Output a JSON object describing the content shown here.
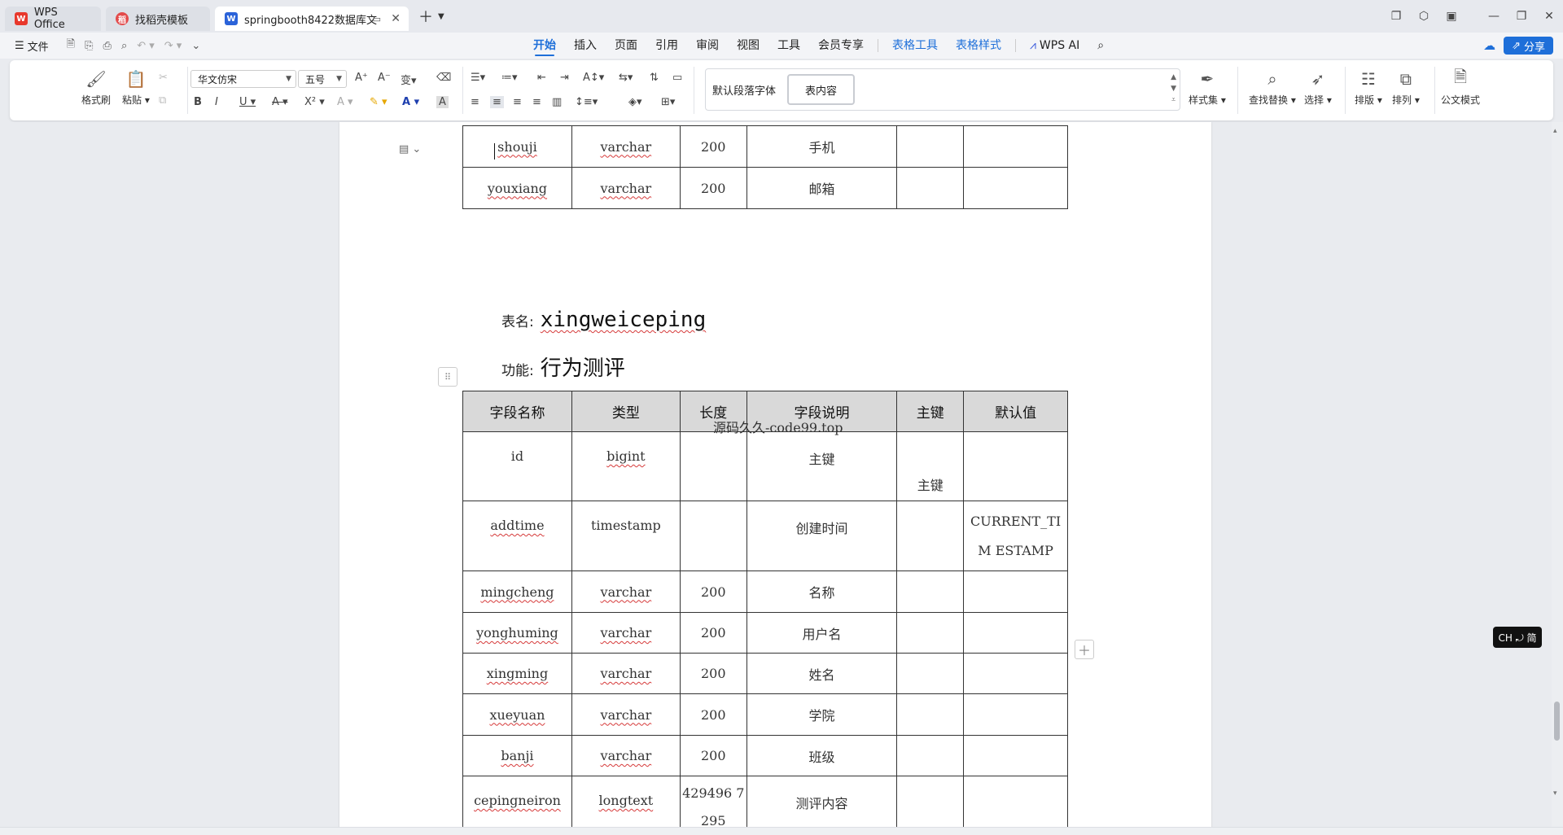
{
  "tabs": [
    {
      "label": "WPS Office",
      "logo": "W"
    },
    {
      "label": "找稻壳模板",
      "logo": "稻"
    },
    {
      "label": "springbooth8422数据库文",
      "logo": "W"
    }
  ],
  "menubar": {
    "file": "文件",
    "items": [
      "开始",
      "插入",
      "页面",
      "引用",
      "审阅",
      "视图",
      "工具",
      "会员专享"
    ],
    "table_tools": "表格工具",
    "table_style": "表格样式",
    "ai": "WPS AI",
    "share": "分享"
  },
  "ribbon": {
    "format_painter": "格式刷",
    "paste": "粘贴",
    "font_name": "华文仿宋",
    "font_size": "五号",
    "style_default": "默认段落字体",
    "style_selected": "表内容",
    "style_set": "样式集",
    "find_replace": "查找替换",
    "select": "选择",
    "layout": "排版",
    "arrange": "排列",
    "official": "公文模式"
  },
  "doc": {
    "top_rows": [
      {
        "name": "shouji",
        "type": "varchar",
        "length": "200",
        "desc": "手机",
        "pk": "",
        "default": ""
      },
      {
        "name": "youxiang",
        "type": "varchar",
        "length": "200",
        "desc": "邮箱",
        "pk": "",
        "default": ""
      }
    ],
    "table_label": "表名:",
    "table_name": "xingweiceping",
    "func_label": "功能:",
    "func_name": "行为测评",
    "headers": [
      "字段名称",
      "类型",
      "长度",
      "字段说明",
      "主键",
      "默认值"
    ],
    "watermark": "源码久久-code99.top",
    "rows": [
      {
        "name": "id",
        "type": "bigint",
        "length": "",
        "desc": "主键",
        "pk": "主键",
        "default": ""
      },
      {
        "name": "addtime",
        "type": "timestamp",
        "length": "",
        "desc": "创建时间",
        "pk": "",
        "default": "CURRENT_TIM ESTAMP"
      },
      {
        "name": "mingcheng",
        "type": "varchar",
        "length": "200",
        "desc": "名称",
        "pk": "",
        "default": ""
      },
      {
        "name": "yonghuming",
        "type": "varchar",
        "length": "200",
        "desc": "用户名",
        "pk": "",
        "default": ""
      },
      {
        "name": "xingming",
        "type": "varchar",
        "length": "200",
        "desc": "姓名",
        "pk": "",
        "default": ""
      },
      {
        "name": "xueyuan",
        "type": "varchar",
        "length": "200",
        "desc": "学院",
        "pk": "",
        "default": ""
      },
      {
        "name": "banji",
        "type": "varchar",
        "length": "200",
        "desc": "班级",
        "pk": "",
        "default": ""
      },
      {
        "name": "cepingneiron",
        "type": "longtext",
        "length": "429496 7295",
        "desc": "测评内容",
        "pk": "",
        "default": ""
      }
    ]
  },
  "ime": "CH ⤾ 简"
}
